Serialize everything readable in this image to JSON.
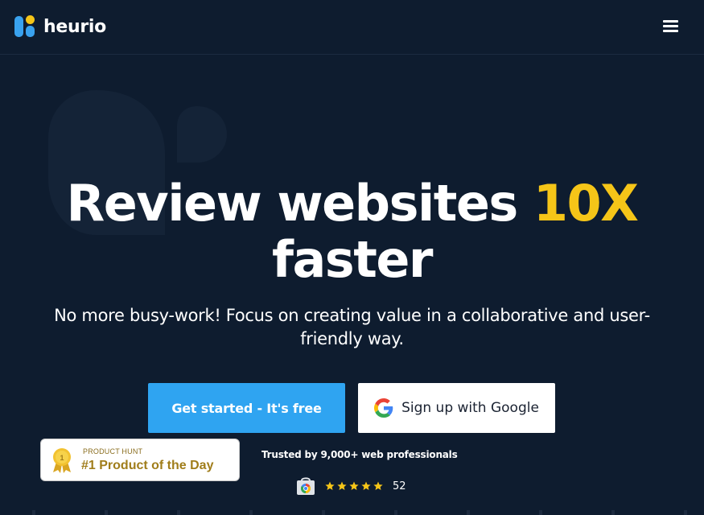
{
  "header": {
    "logo_text": "heurio",
    "menu_icon": "hamburger-menu-icon"
  },
  "hero": {
    "headline_part1": "Review websites ",
    "headline_accent": "10X",
    "headline_part2": "faster",
    "subhead": "No more busy-work! Focus on creating value in a collaborative and user-friendly way."
  },
  "cta": {
    "primary_label": "Get started - It's free",
    "google_label": "Sign up with Google",
    "google_icon": "google-logo-icon"
  },
  "product_hunt": {
    "label": "PRODUCT HUNT",
    "title": "#1 Product of the Day",
    "icon": "medal-icon"
  },
  "social_proof": {
    "trusted_text": "Trusted by 9,000+ web professionals",
    "rating_count": "52",
    "stars": 5,
    "store_icon": "chrome-web-store-icon"
  },
  "colors": {
    "background": "#0e1c2f",
    "accent_yellow": "#f5c518",
    "primary_blue": "#2fa4f1",
    "white": "#ffffff"
  }
}
